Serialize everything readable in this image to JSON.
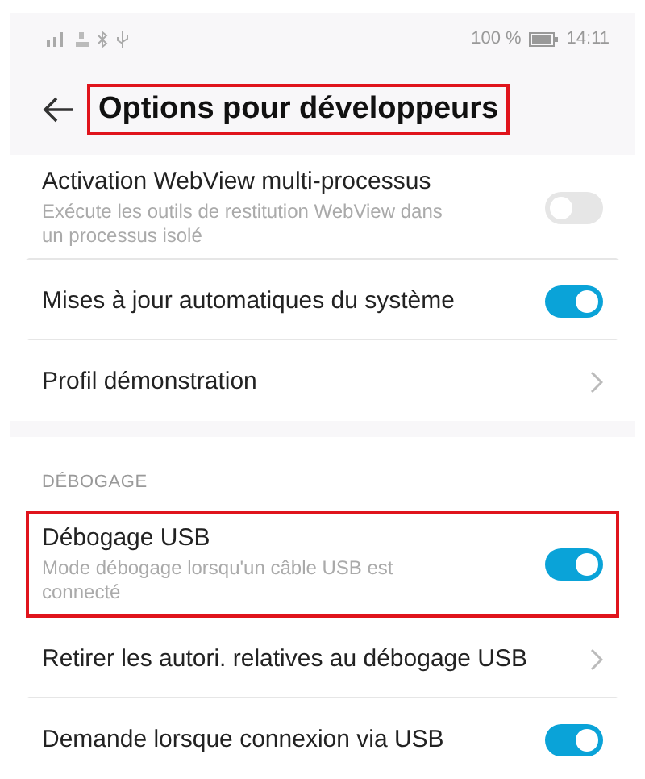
{
  "status_bar": {
    "battery": "100 %",
    "time": "14:11"
  },
  "header": {
    "title": "Options pour développeurs",
    "highlighted": true
  },
  "sections": [
    {
      "items": [
        {
          "kind": "toggle",
          "title": "Activation WebView multi-processus",
          "description": "Exécute les outils de restitution WebView dans un processus isolé",
          "on": false,
          "highlighted": false
        },
        {
          "kind": "toggle",
          "title": "Mises à jour automatiques du système",
          "on": true,
          "highlighted": false
        },
        {
          "kind": "link",
          "title": "Profil démonstration",
          "highlighted": false
        }
      ]
    },
    {
      "heading": "DÉBOGAGE",
      "items": [
        {
          "kind": "toggle",
          "title": "Débogage USB",
          "description": "Mode débogage lorsqu'un câble USB est connecté",
          "on": true,
          "highlighted": true
        },
        {
          "kind": "link",
          "title": "Retirer les autori. relatives au débogage USB",
          "highlighted": false
        },
        {
          "kind": "toggle",
          "title": "Demande lorsque connexion via USB",
          "on": true,
          "highlighted": false
        }
      ]
    }
  ]
}
